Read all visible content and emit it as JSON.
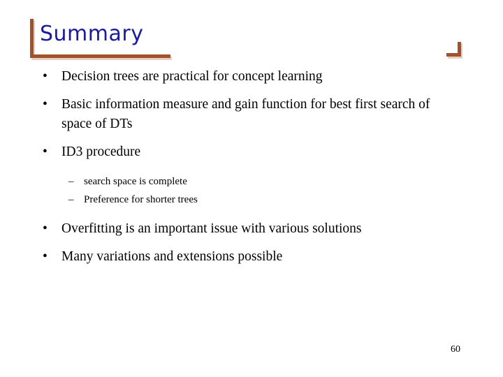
{
  "slide": {
    "title": "Summary",
    "page_number": "60",
    "colors": {
      "title_text": "#1b1b9e",
      "accent_bracket": "#a0522d",
      "bracket_shadow": "#e8cdc0",
      "body_text": "#000000",
      "background": "#ffffff"
    },
    "decorations": {
      "left_bracket_name": "title-corner-bracket-left",
      "right_bracket_name": "title-corner-bracket-right"
    },
    "bullets": [
      {
        "level": 1,
        "marker": "•",
        "text": "Decision trees are practical for concept learning"
      },
      {
        "level": 1,
        "marker": "•",
        "text": "Basic information measure and gain function for best first search of space of DTs"
      },
      {
        "level": 1,
        "marker": "•",
        "text": "ID3 procedure"
      },
      {
        "level": 2,
        "marker": "–",
        "text": "search space is complete"
      },
      {
        "level": 2,
        "marker": "–",
        "text": "Preference for shorter trees"
      },
      {
        "level": 1,
        "marker": "•",
        "text": "Overfitting is an important issue with various solutions"
      },
      {
        "level": 1,
        "marker": "•",
        "text": "Many variations and extensions possible"
      }
    ]
  }
}
